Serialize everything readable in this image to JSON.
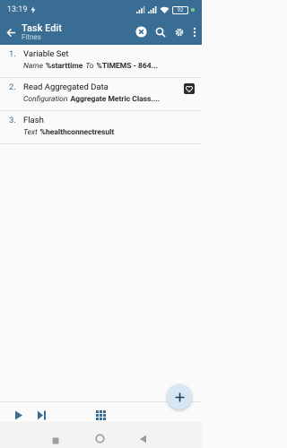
{
  "status_bar": {
    "time": "13:19",
    "battery": "92"
  },
  "app_bar": {
    "title": "Task Edit",
    "subtitle": "Fitnes"
  },
  "actions": [
    {
      "number": "1.",
      "name": "Variable Set",
      "detail": [
        {
          "key": "Name",
          "value": "%starttime"
        },
        {
          "key": "To",
          "value": "%TIMEMS - 864..."
        }
      ]
    },
    {
      "number": "2.",
      "name": "Read Aggregated Data",
      "detail": [
        {
          "key": "Configuration",
          "value": "Aggregate Metric Class...."
        }
      ],
      "icon": "health-connect-icon"
    },
    {
      "number": "3.",
      "name": "Flash",
      "detail": [
        {
          "key": "Text",
          "value": "%healthconnectresult"
        }
      ]
    }
  ],
  "colors": {
    "primary": "#3a6d93",
    "accent": "#3a6d93",
    "fab_bg": "#d6e6f2"
  }
}
